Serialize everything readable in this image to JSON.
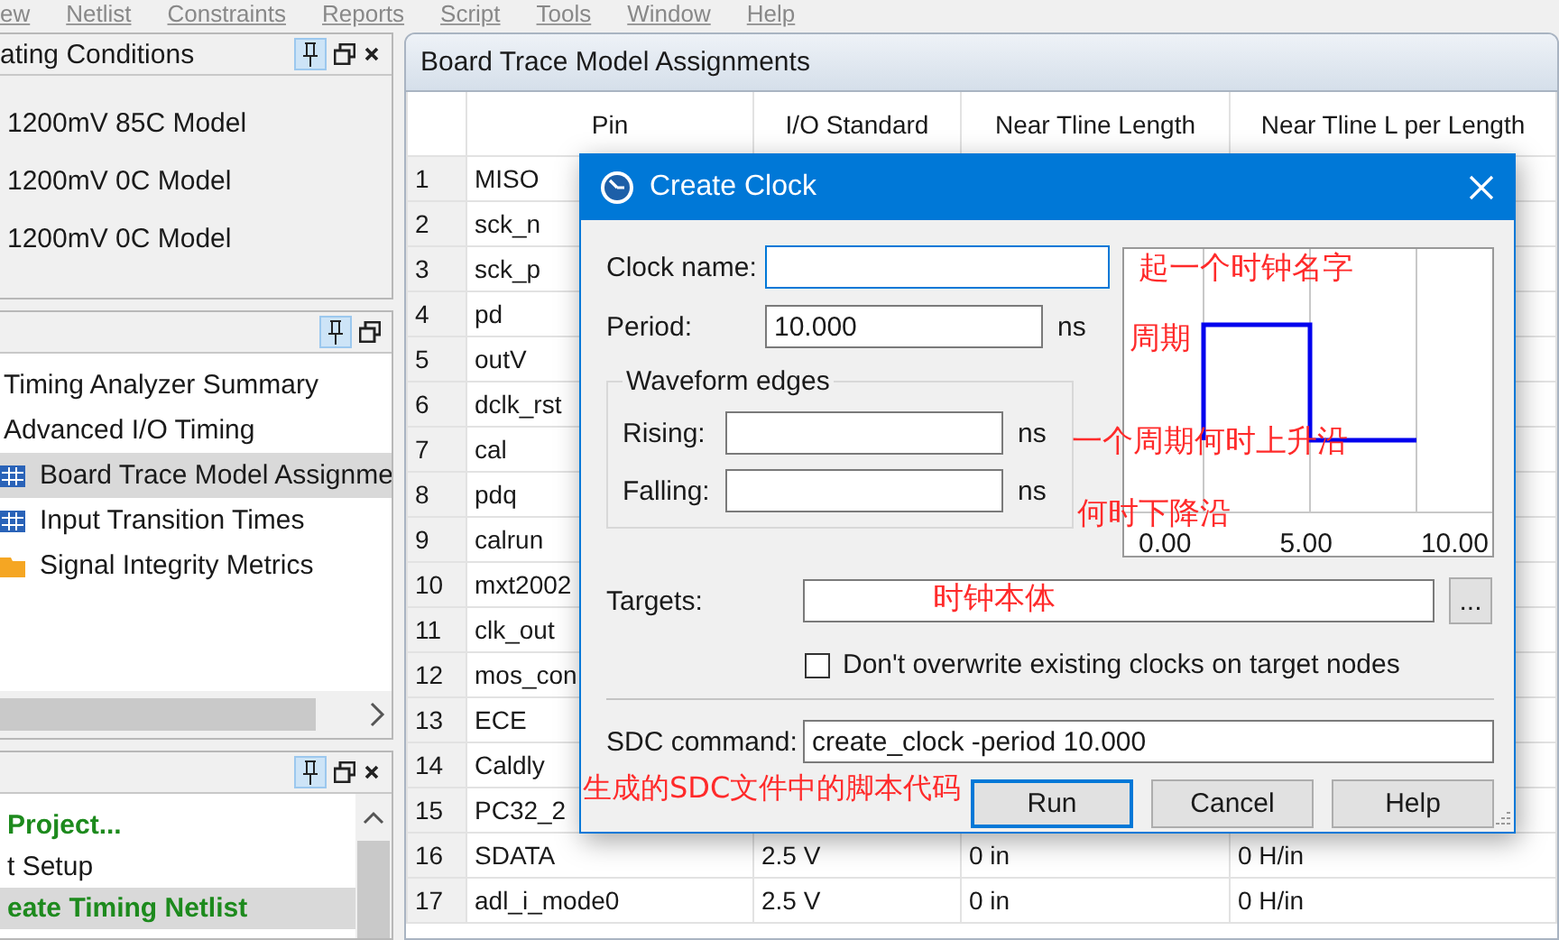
{
  "menu_bar": {
    "items": [
      "ew",
      "Netlist",
      "Constraints",
      "Reports",
      "Script",
      "Tools",
      "Window",
      "Help"
    ]
  },
  "left_panels": [
    {
      "title": "ating Conditions",
      "closable": true,
      "shaded": true,
      "items": [
        {
          "label": "1200mV 85C Model",
          "kind": "plain",
          "selected": false
        },
        {
          "label": "1200mV 0C Model",
          "kind": "plain",
          "selected": false
        },
        {
          "label": "1200mV 0C Model",
          "kind": "plain",
          "selected": false
        }
      ]
    },
    {
      "closable": false,
      "shaded": false,
      "items": [
        {
          "label": "Timing Analyzer Summary",
          "kind": "plain",
          "selected": false
        },
        {
          "label": "Advanced I/O Timing",
          "kind": "plain",
          "selected": false
        },
        {
          "label": "Board Trace Model Assignme",
          "kind": "table",
          "selected": true
        },
        {
          "label": "Input Transition Times",
          "kind": "table",
          "selected": false
        },
        {
          "label": "Signal Integrity Metrics",
          "kind": "folder",
          "selected": false
        }
      ]
    },
    {
      "closable": true,
      "shaded": false,
      "items": [
        {
          "label": "Project...",
          "kind": "command",
          "selected": false
        },
        {
          "label": "t Setup",
          "kind": "plain",
          "selected": false
        },
        {
          "label": "eate Timing Netlist",
          "kind": "command",
          "selected": true
        }
      ]
    }
  ],
  "report": {
    "title": "Board Trace Model Assignments",
    "columns": [
      "Pin",
      "I/O Standard",
      "Near Tline Length",
      "Near Tline L per Length"
    ],
    "rows": [
      {
        "index": "1",
        "pin": "MISO"
      },
      {
        "index": "2",
        "pin": "sck_n"
      },
      {
        "index": "3",
        "pin": "sck_p"
      },
      {
        "index": "4",
        "pin": "pd"
      },
      {
        "index": "5",
        "pin": "outV"
      },
      {
        "index": "6",
        "pin": "dclk_rst"
      },
      {
        "index": "7",
        "pin": "cal"
      },
      {
        "index": "8",
        "pin": "pdq"
      },
      {
        "index": "9",
        "pin": "calrun"
      },
      {
        "index": "10",
        "pin": "mxt2002"
      },
      {
        "index": "11",
        "pin": "clk_out"
      },
      {
        "index": "12",
        "pin": "mos_con"
      },
      {
        "index": "13",
        "pin": "ECE"
      },
      {
        "index": "14",
        "pin": "Caldly"
      },
      {
        "index": "15",
        "pin": "PC32_2"
      },
      {
        "index": "16",
        "pin": "SDATA",
        "io_standard": "2.5 V",
        "near_tline_length": "0 in",
        "near_tline_l_per_length": "0 H/in"
      },
      {
        "index": "17",
        "pin": "adl_i_mode0",
        "io_standard": "2.5 V",
        "near_tline_length": "0 in",
        "near_tline_l_per_length": "0 H/in"
      }
    ]
  },
  "dialog": {
    "title": "Create Clock",
    "clock_name": {
      "label": "Clock name:"
    },
    "period": {
      "label": "Period:",
      "value": "10.000",
      "unit": "ns"
    },
    "waveform_edges": {
      "title": "Waveform edges",
      "rising": {
        "label": "Rising:",
        "unit": "ns"
      },
      "falling": {
        "label": "Falling:",
        "unit": "ns"
      }
    },
    "waveform": {
      "axis_labels": [
        "0.00",
        "5.00",
        "10.00"
      ]
    },
    "targets": {
      "label": "Targets:",
      "browse_button": "..."
    },
    "dont_overwrite": {
      "label": "Don't overwrite existing clocks on target nodes",
      "checked": false
    },
    "sdc_command": {
      "label": "SDC command:",
      "value": "create_clock -period 10.000"
    },
    "buttons": [
      {
        "label": "Run",
        "default": true
      },
      {
        "label": "Cancel",
        "default": false
      },
      {
        "label": "Help",
        "default": false
      }
    ]
  },
  "annotations": [
    "起一个时钟名字",
    "周期",
    "一个周期何时上升沿",
    "何时下降沿",
    "时钟本体",
    "生成的SDC文件中的脚本代码"
  ]
}
